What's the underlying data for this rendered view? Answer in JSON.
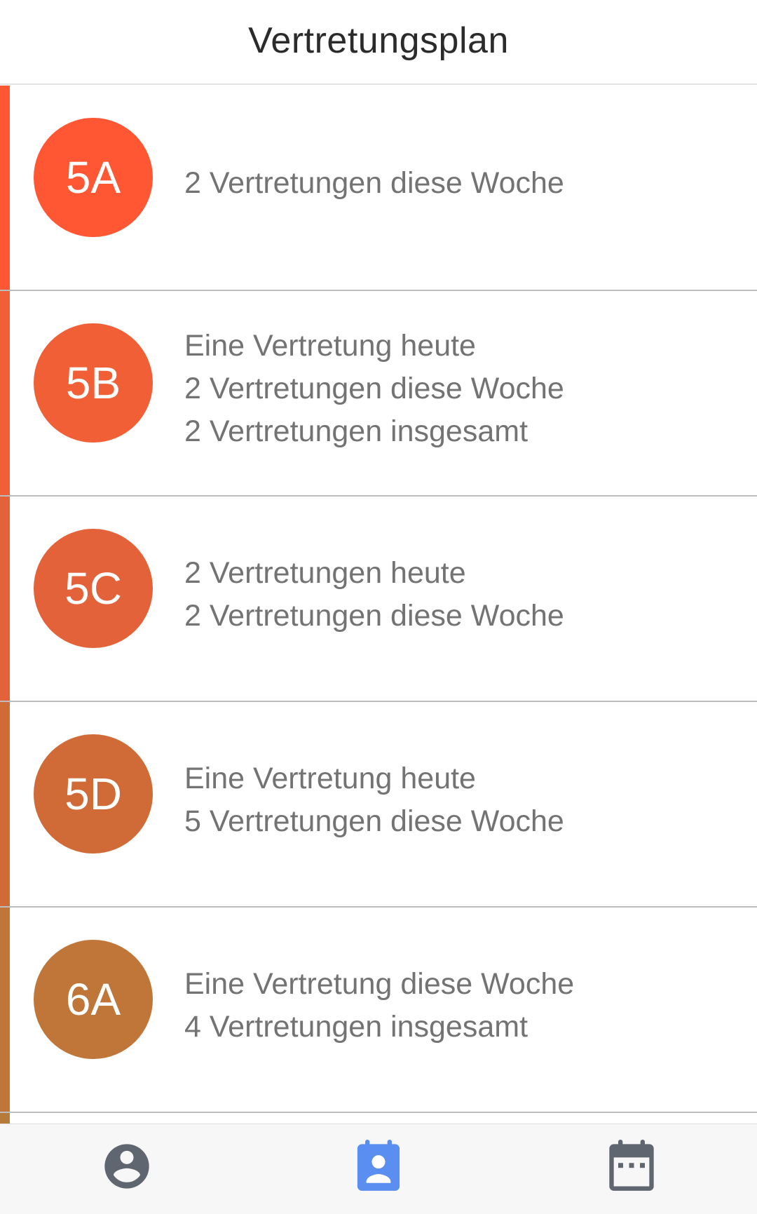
{
  "app": {
    "title": "Vertretungsplan"
  },
  "classes": [
    {
      "name": "5A",
      "color": "#FF5733",
      "lines": [
        "2 Vertretungen diese Woche"
      ]
    },
    {
      "name": "5B",
      "color": "#F05F36",
      "lines": [
        "Eine Vertretung heute",
        "2 Vertretungen diese Woche",
        "2 Vertretungen insgesamt"
      ]
    },
    {
      "name": "5C",
      "color": "#E4623A",
      "lines": [
        "2 Vertretungen heute",
        "2 Vertretungen diese Woche"
      ]
    },
    {
      "name": "5D",
      "color": "#D06A37",
      "lines": [
        "Eine Vertretung heute",
        "5 Vertretungen diese Woche"
      ]
    },
    {
      "name": "6A",
      "color": "#BF7638",
      "lines": [
        "Eine Vertretung diese Woche",
        "4 Vertretungen insgesamt"
      ]
    }
  ],
  "bottom_nav": {
    "items": [
      {
        "icon": "account-circle-icon",
        "active": false,
        "color": "#5F6670"
      },
      {
        "icon": "contact-calendar-icon",
        "active": true,
        "color": "#5A8EF0"
      },
      {
        "icon": "calendar-icon",
        "active": false,
        "color": "#5F6670"
      }
    ]
  }
}
